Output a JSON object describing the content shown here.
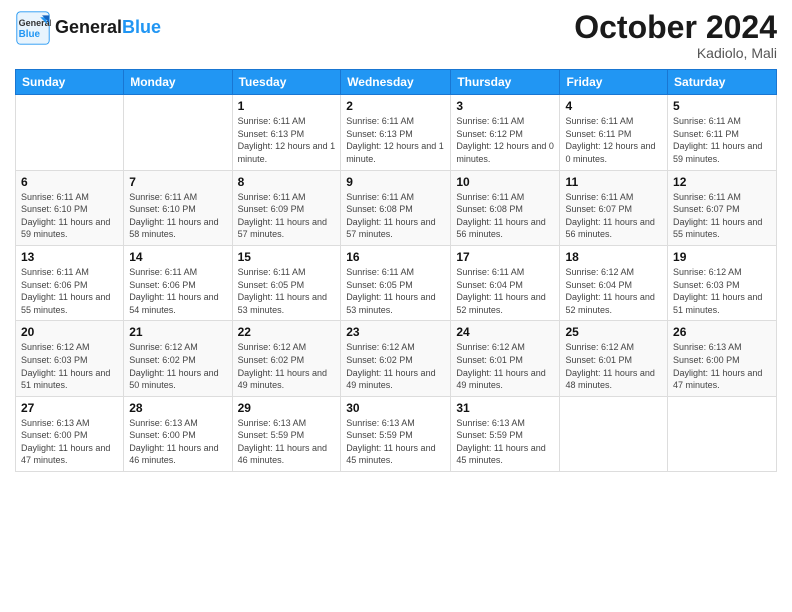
{
  "logo": {
    "text_general": "General",
    "text_blue": "Blue"
  },
  "header": {
    "month": "October 2024",
    "location": "Kadiolo, Mali"
  },
  "weekdays": [
    "Sunday",
    "Monday",
    "Tuesday",
    "Wednesday",
    "Thursday",
    "Friday",
    "Saturday"
  ],
  "weeks": [
    [
      null,
      null,
      {
        "day": "1",
        "sunrise": "6:11 AM",
        "sunset": "6:13 PM",
        "daylight": "12 hours and 1 minute."
      },
      {
        "day": "2",
        "sunrise": "6:11 AM",
        "sunset": "6:13 PM",
        "daylight": "12 hours and 1 minute."
      },
      {
        "day": "3",
        "sunrise": "6:11 AM",
        "sunset": "6:12 PM",
        "daylight": "12 hours and 0 minutes."
      },
      {
        "day": "4",
        "sunrise": "6:11 AM",
        "sunset": "6:11 PM",
        "daylight": "12 hours and 0 minutes."
      },
      {
        "day": "5",
        "sunrise": "6:11 AM",
        "sunset": "6:11 PM",
        "daylight": "11 hours and 59 minutes."
      }
    ],
    [
      {
        "day": "6",
        "sunrise": "6:11 AM",
        "sunset": "6:10 PM",
        "daylight": "11 hours and 59 minutes."
      },
      {
        "day": "7",
        "sunrise": "6:11 AM",
        "sunset": "6:10 PM",
        "daylight": "11 hours and 58 minutes."
      },
      {
        "day": "8",
        "sunrise": "6:11 AM",
        "sunset": "6:09 PM",
        "daylight": "11 hours and 57 minutes."
      },
      {
        "day": "9",
        "sunrise": "6:11 AM",
        "sunset": "6:08 PM",
        "daylight": "11 hours and 57 minutes."
      },
      {
        "day": "10",
        "sunrise": "6:11 AM",
        "sunset": "6:08 PM",
        "daylight": "11 hours and 56 minutes."
      },
      {
        "day": "11",
        "sunrise": "6:11 AM",
        "sunset": "6:07 PM",
        "daylight": "11 hours and 56 minutes."
      },
      {
        "day": "12",
        "sunrise": "6:11 AM",
        "sunset": "6:07 PM",
        "daylight": "11 hours and 55 minutes."
      }
    ],
    [
      {
        "day": "13",
        "sunrise": "6:11 AM",
        "sunset": "6:06 PM",
        "daylight": "11 hours and 55 minutes."
      },
      {
        "day": "14",
        "sunrise": "6:11 AM",
        "sunset": "6:06 PM",
        "daylight": "11 hours and 54 minutes."
      },
      {
        "day": "15",
        "sunrise": "6:11 AM",
        "sunset": "6:05 PM",
        "daylight": "11 hours and 53 minutes."
      },
      {
        "day": "16",
        "sunrise": "6:11 AM",
        "sunset": "6:05 PM",
        "daylight": "11 hours and 53 minutes."
      },
      {
        "day": "17",
        "sunrise": "6:11 AM",
        "sunset": "6:04 PM",
        "daylight": "11 hours and 52 minutes."
      },
      {
        "day": "18",
        "sunrise": "6:12 AM",
        "sunset": "6:04 PM",
        "daylight": "11 hours and 52 minutes."
      },
      {
        "day": "19",
        "sunrise": "6:12 AM",
        "sunset": "6:03 PM",
        "daylight": "11 hours and 51 minutes."
      }
    ],
    [
      {
        "day": "20",
        "sunrise": "6:12 AM",
        "sunset": "6:03 PM",
        "daylight": "11 hours and 51 minutes."
      },
      {
        "day": "21",
        "sunrise": "6:12 AM",
        "sunset": "6:02 PM",
        "daylight": "11 hours and 50 minutes."
      },
      {
        "day": "22",
        "sunrise": "6:12 AM",
        "sunset": "6:02 PM",
        "daylight": "11 hours and 49 minutes."
      },
      {
        "day": "23",
        "sunrise": "6:12 AM",
        "sunset": "6:02 PM",
        "daylight": "11 hours and 49 minutes."
      },
      {
        "day": "24",
        "sunrise": "6:12 AM",
        "sunset": "6:01 PM",
        "daylight": "11 hours and 49 minutes."
      },
      {
        "day": "25",
        "sunrise": "6:12 AM",
        "sunset": "6:01 PM",
        "daylight": "11 hours and 48 minutes."
      },
      {
        "day": "26",
        "sunrise": "6:13 AM",
        "sunset": "6:00 PM",
        "daylight": "11 hours and 47 minutes."
      }
    ],
    [
      {
        "day": "27",
        "sunrise": "6:13 AM",
        "sunset": "6:00 PM",
        "daylight": "11 hours and 47 minutes."
      },
      {
        "day": "28",
        "sunrise": "6:13 AM",
        "sunset": "6:00 PM",
        "daylight": "11 hours and 46 minutes."
      },
      {
        "day": "29",
        "sunrise": "6:13 AM",
        "sunset": "5:59 PM",
        "daylight": "11 hours and 46 minutes."
      },
      {
        "day": "30",
        "sunrise": "6:13 AM",
        "sunset": "5:59 PM",
        "daylight": "11 hours and 45 minutes."
      },
      {
        "day": "31",
        "sunrise": "6:13 AM",
        "sunset": "5:59 PM",
        "daylight": "11 hours and 45 minutes."
      },
      null,
      null
    ]
  ],
  "labels": {
    "sunrise": "Sunrise:",
    "sunset": "Sunset:",
    "daylight": "Daylight:"
  }
}
